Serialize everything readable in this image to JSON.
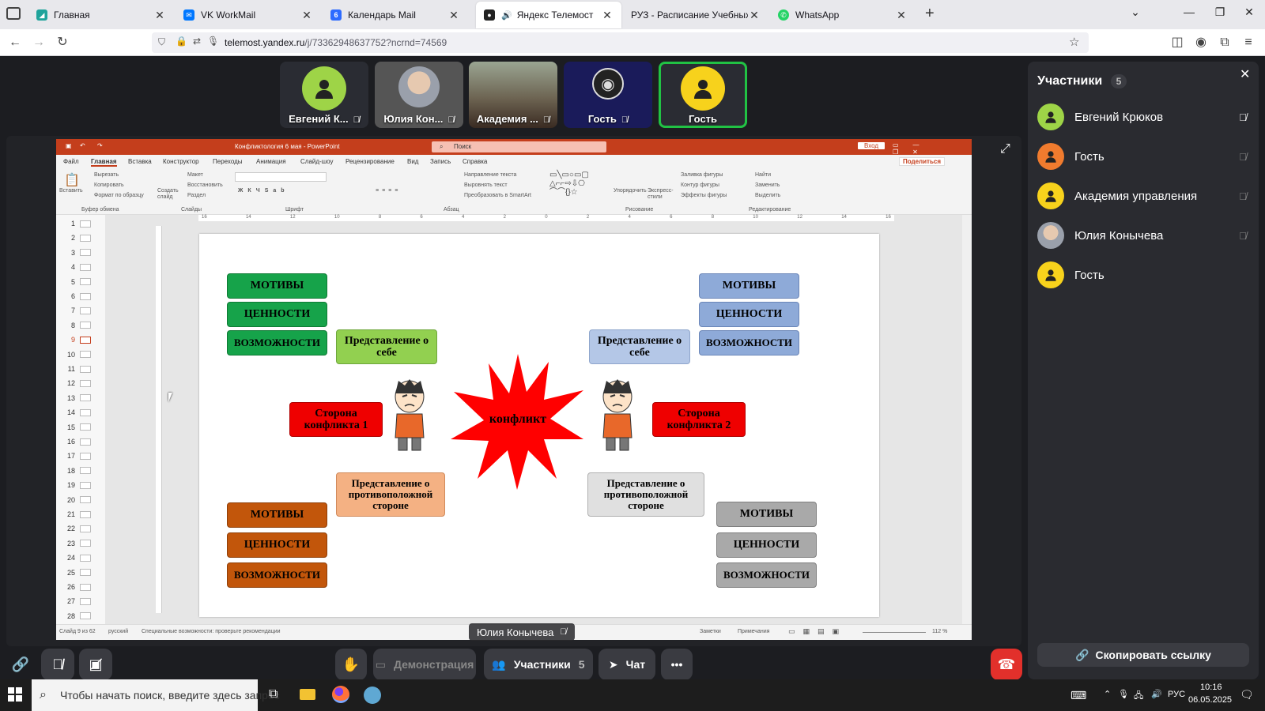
{
  "browser": {
    "tabs": [
      {
        "label": "Главная",
        "icon": "edu-icon",
        "color": "#1fa39b",
        "active": false
      },
      {
        "label": "VK WorkMail",
        "icon": "vk-icon",
        "color": "#0077ff",
        "active": false
      },
      {
        "label": "Календарь Mail",
        "icon": "calendar-icon",
        "color": "#2d6bff",
        "active": false
      },
      {
        "label": "Яндекс Телемост",
        "icon": "telemost-icon",
        "color": "#222",
        "active": true
      },
      {
        "label": "РУЗ - Расписание Учебных Занятий",
        "icon": "none",
        "color": "#888",
        "active": false
      },
      {
        "label": "WhatsApp",
        "icon": "whatsapp-icon",
        "color": "#25d366",
        "active": false
      }
    ],
    "new_tab": "+",
    "url_host": "telemost.yandex.ru",
    "url_path": "/j/73362948637752?ncrnd=74569"
  },
  "video_tiles": [
    {
      "name": "Евгений К...",
      "type": "avatar",
      "color": "#9ed447"
    },
    {
      "name": "Юлия Кон...",
      "type": "photo"
    },
    {
      "name": "Академия ...",
      "type": "room"
    },
    {
      "name": "Гость",
      "type": "obs"
    },
    {
      "name": "Гость",
      "type": "avatar",
      "color": "#f7d21c",
      "speaking": true
    }
  ],
  "powerpoint": {
    "title": "Конфликтология 6 мая - PowerPoint",
    "search_placeholder": "Поиск",
    "login": "Вход",
    "share": "Поделиться",
    "tabs": [
      "Файл",
      "Главная",
      "Вставка",
      "Конструктор",
      "Переходы",
      "Анимация",
      "Слайд-шоу",
      "Рецензирование",
      "Вид",
      "Запись",
      "Справка"
    ],
    "groups": {
      "clipboard": "Буфер обмена",
      "clip_paste": "Вставить",
      "clip_cut": "Вырезать",
      "clip_copy": "Копировать",
      "clip_format": "Формат по образцу",
      "slides": "Слайды",
      "slides_new": "Создать слайд",
      "slides_layout": "Макет",
      "slides_reset": "Восстановить",
      "slides_section": "Раздел",
      "font": "Шрифт",
      "paragraph": "Абзац",
      "par_dir": "Направление текста",
      "par_align": "Выровнять текст",
      "par_smartart": "Преобразовать в SmartArt",
      "drawing": "Рисование",
      "draw_arrange": "Упорядочить",
      "draw_styles": "Экспресс-стили",
      "draw_fill": "Заливка фигуры",
      "draw_outline": "Контур фигуры",
      "draw_effects": "Эффекты фигуры",
      "editing": "Редактирование",
      "edit_find": "Найти",
      "edit_replace": "Заменить",
      "edit_select": "Выделить"
    },
    "slide_numbers": [
      "1",
      "2",
      "3",
      "4",
      "5",
      "6",
      "7",
      "8",
      "9",
      "10",
      "11",
      "12",
      "13",
      "14",
      "15",
      "16",
      "17",
      "18",
      "19",
      "20",
      "21",
      "22",
      "23",
      "24",
      "25",
      "26",
      "27",
      "28"
    ],
    "status_left": "Слайд 9 из 62",
    "status_lang": "русский",
    "status_access": "Специальные возможности: проверьте рекомендации",
    "status_notes": "Заметки",
    "status_comments": "Примечания",
    "zoom": "112 %",
    "ruler_labels": [
      "16",
      "15",
      "14",
      "13",
      "12",
      "11",
      "10",
      "9",
      "8",
      "7",
      "6",
      "5",
      "4",
      "3",
      "2",
      "1",
      "0",
      "1",
      "2",
      "3",
      "4",
      "5",
      "6",
      "7",
      "8",
      "9",
      "10",
      "11",
      "12",
      "13",
      "14",
      "15",
      "16"
    ],
    "slide": {
      "green": [
        "МОТИВЫ",
        "ЦЕННОСТИ",
        "ВОЗМОЖНОСТИ"
      ],
      "blue": [
        "МОТИВЫ",
        "ЦЕННОСТИ",
        "ВОЗМОЖНОСТИ"
      ],
      "orange": [
        "МОТИВЫ",
        "ЦЕННОСТИ",
        "ВОЗМОЖНОСТИ"
      ],
      "grey": [
        "МОТИВЫ",
        "ЦЕННОСТИ",
        "ВОЗМОЖНОСТИ"
      ],
      "self_left": "Представление о себе",
      "self_right": "Представление о себе",
      "side1": "Сторона конфликта 1",
      "side2": "Сторона конфликта 2",
      "conflict": "конфликт",
      "other_left": "Представление о противоположной стороне",
      "other_right": "Представление о противоположной стороне"
    }
  },
  "presenter_label": "Юлия Конычева",
  "participants": {
    "title": "Участники",
    "count": "5",
    "list": [
      {
        "name": "Евгений Крюков",
        "color": "#9ed447"
      },
      {
        "name": "Гость",
        "color": "#f07b2e"
      },
      {
        "name": "Академия управления",
        "color": "#f7d21c"
      },
      {
        "name": "Юлия Конычева",
        "color": "photo"
      },
      {
        "name": "Гость",
        "color": "#f7d21c"
      }
    ],
    "copy_link": "Скопировать ссылку"
  },
  "controls": {
    "demo": "Демонстрация",
    "participants": "Участники",
    "participants_count": "5",
    "chat": "Чат",
    "more": "•••"
  },
  "taskbar": {
    "search_placeholder": "Чтобы начать поиск, введите здесь запрос",
    "lang": "РУС",
    "time": "10:16",
    "date": "06.05.2025"
  }
}
